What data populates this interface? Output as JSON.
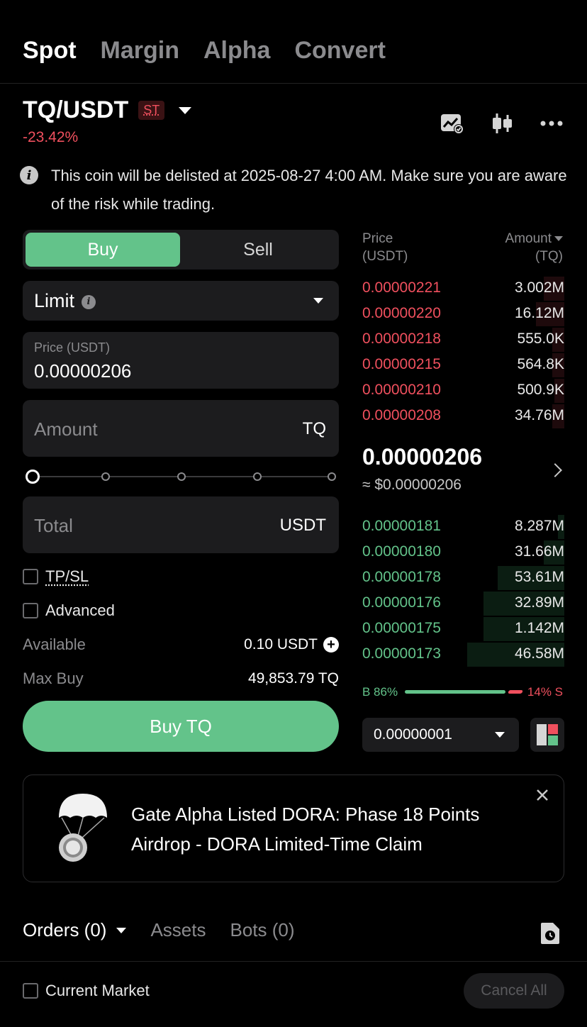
{
  "top_tabs": [
    "Spot",
    "Margin",
    "Alpha",
    "Convert"
  ],
  "pair": {
    "name": "TQ/USDT",
    "badge": "ST",
    "change": "-23.42%"
  },
  "notice": "This coin will be delisted at 2025-08-27 4:00 AM. Make sure you are aware of the risk while trading.",
  "order_form": {
    "buy_label": "Buy",
    "sell_label": "Sell",
    "order_type": "Limit",
    "price_label": "Price (USDT)",
    "price_value": "0.00000206",
    "amount_placeholder": "Amount",
    "amount_unit": "TQ",
    "total_placeholder": "Total",
    "total_unit": "USDT",
    "tpsl_label": "TP/SL",
    "advanced_label": "Advanced",
    "available_label": "Available",
    "available_value": "0.10 USDT",
    "max_buy_label": "Max Buy",
    "max_buy_value": "49,853.79 TQ",
    "submit_label": "Buy TQ"
  },
  "order_book": {
    "price_header_1": "Price",
    "price_header_2": "(USDT)",
    "amount_header_1": "Amount",
    "amount_header_2": "(TQ)",
    "asks": [
      {
        "price": "0.00000221",
        "amount": "3.002M",
        "depth": 0.1
      },
      {
        "price": "0.00000220",
        "amount": "16.12M",
        "depth": 0.14
      },
      {
        "price": "0.00000218",
        "amount": "555.0K",
        "depth": 0.06
      },
      {
        "price": "0.00000215",
        "amount": "564.8K",
        "depth": 0.06
      },
      {
        "price": "0.00000210",
        "amount": "500.9K",
        "depth": 0.05
      },
      {
        "price": "0.00000208",
        "amount": "34.76M",
        "depth": 0.06
      }
    ],
    "last_price": "0.00000206",
    "last_price_usd": "≈ $0.00000206",
    "bids": [
      {
        "price": "0.00000181",
        "amount": "8.287M",
        "depth": 0.03
      },
      {
        "price": "0.00000180",
        "amount": "31.66M",
        "depth": 0.1
      },
      {
        "price": "0.00000178",
        "amount": "53.61M",
        "depth": 0.33
      },
      {
        "price": "0.00000176",
        "amount": "32.89M",
        "depth": 0.4
      },
      {
        "price": "0.00000175",
        "amount": "1.142M",
        "depth": 0.4
      },
      {
        "price": "0.00000173",
        "amount": "46.58M",
        "depth": 0.48
      }
    ],
    "buy_ratio_label": "B 86%",
    "sell_ratio_label": "14% S",
    "buy_ratio": 0.86,
    "precision": "0.00000001"
  },
  "banner": {
    "text": "Gate Alpha Listed DORA: Phase 18 Points Airdrop - DORA Limited-Time Claim"
  },
  "bottom": {
    "tabs": [
      "Orders (0)",
      "Assets",
      "Bots (0)"
    ],
    "current_market_label": "Current Market",
    "cancel_all_label": "Cancel All"
  },
  "colors": {
    "buy_green": "#63c38a",
    "sell_red": "#f0505e",
    "background": "#000000",
    "panel": "#1c1c1e"
  }
}
